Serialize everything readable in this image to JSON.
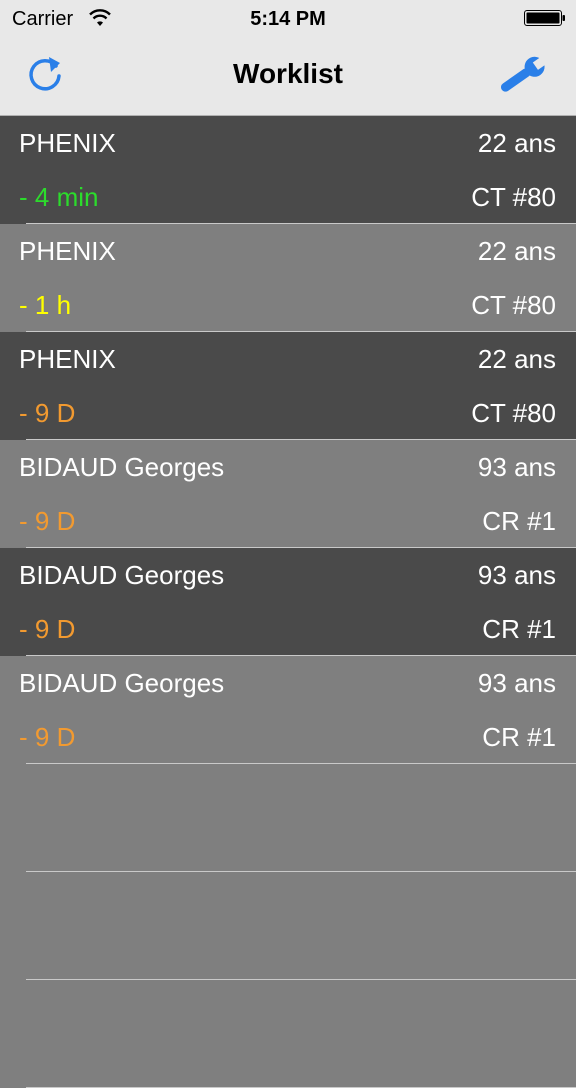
{
  "status_bar": {
    "carrier": "Carrier",
    "time": "5:14 PM"
  },
  "nav": {
    "title": "Worklist",
    "left_icon": "refresh-icon",
    "right_icon": "wrench-icon",
    "accent_color": "#2a7fe8"
  },
  "rows": [
    {
      "name": "PHENIX",
      "age": "22 ans",
      "delay": "- 4 min",
      "exam": "CT #80",
      "delay_color": "#2cdc2c",
      "shade": "dark"
    },
    {
      "name": "PHENIX",
      "age": "22 ans",
      "delay": "- 1 h",
      "exam": "CT #80",
      "delay_color": "#ffff00",
      "shade": "light"
    },
    {
      "name": "PHENIX",
      "age": "22 ans",
      "delay": "- 9 D",
      "exam": "CT #80",
      "delay_color": "#f29a30",
      "shade": "dark"
    },
    {
      "name": "BIDAUD Georges",
      "age": "93 ans",
      "delay": "- 9 D",
      "exam": "CR #1",
      "delay_color": "#f29a30",
      "shade": "light"
    },
    {
      "name": "BIDAUD Georges",
      "age": "93 ans",
      "delay": "- 9 D",
      "exam": "CR #1",
      "delay_color": "#f29a30",
      "shade": "dark"
    },
    {
      "name": "BIDAUD Georges",
      "age": "93 ans",
      "delay": "- 9 D",
      "exam": "CR #1",
      "delay_color": "#f29a30",
      "shade": "light"
    }
  ]
}
